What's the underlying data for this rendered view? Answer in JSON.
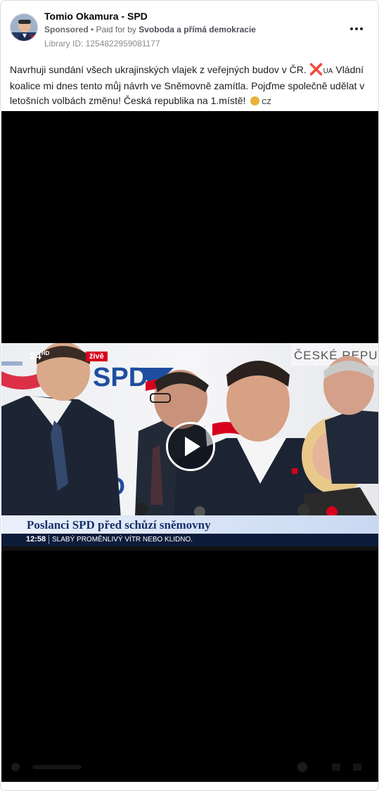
{
  "post": {
    "page_name": "Tomio Okamura - SPD",
    "sponsored": "Sponsored",
    "separator": " • ",
    "paid_for_prefix": "Paid for by ",
    "payer": "Svoboda a přímá demokracie",
    "library_id": "Library ID: 1254822959081177",
    "text_part1": "Navrhuji sundání všech ukrajinských vlajek z veřejných budov v ČR. ",
    "emoji_x": "❌",
    "flag_ua": "UA",
    "text_part2": " Vládní koalice mi dnes tento můj návrh ve Sněmovně zamítla. Pojďme společně udělat v letošních volbách změnu! Česká republika na 1.místě! ",
    "flag_cz": "CZ"
  },
  "video": {
    "channel_logo": "24",
    "channel_logo_sup": "HD",
    "live_badge": "živě",
    "backdrop_logo": "SPD",
    "banner_text": "ČESKÉ REPUBLIK",
    "headline": "Poslanci SPD před schůzí sněmovny",
    "ticker_time": "12:58",
    "ticker_text": "SLABÝ PROMĚNLIVÝ VÍTR NEBO KLIDNO."
  },
  "icons": {
    "avatar": "avatar",
    "more": "more-horizontal-icon",
    "play": "play-icon"
  },
  "colors": {
    "video_background": "#000000",
    "headline_color": "#17306b",
    "live_badge": "#d7001c"
  }
}
